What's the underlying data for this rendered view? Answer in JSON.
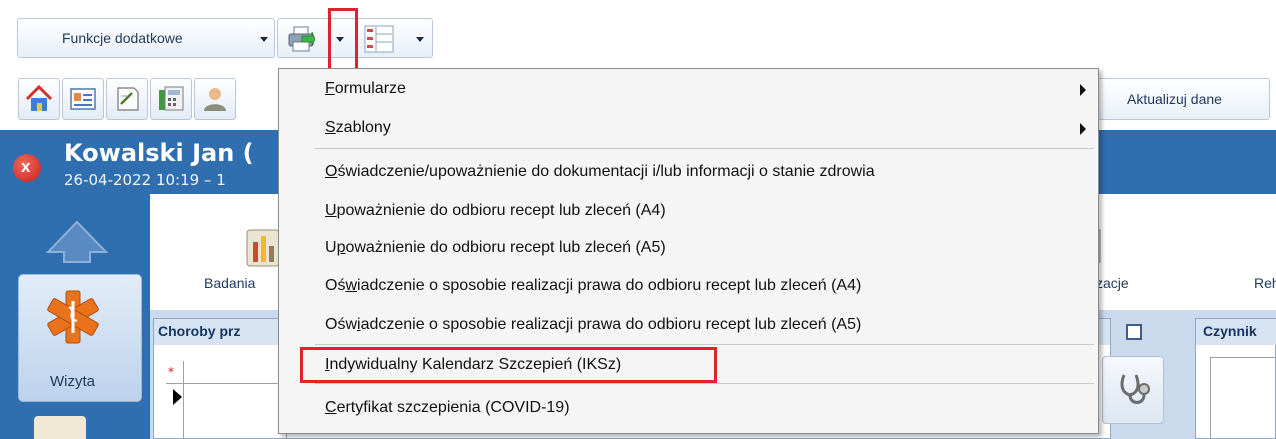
{
  "toolbar": {
    "funkcje_label": "Funkcje dodatkowe",
    "aktualizuj_label": "Aktualizuj dane",
    "icons": [
      "home-icon",
      "patient-card-icon",
      "notes-icon",
      "calculator-icon",
      "user-icon"
    ]
  },
  "patient": {
    "name": "Kowalski Jan (",
    "visit": "26-04-2022 10:19 – 1",
    "close_glyph": "x"
  },
  "nav": {
    "wizyta_label": "Wizyta"
  },
  "ribbon": {
    "badania_label": "Badania",
    "realizacje_label": "alizacje",
    "reh_label": "Reh"
  },
  "panels": {
    "choroby_title": "Choroby prz",
    "czynnik_title": "Czynnik",
    "grid_marker": "*"
  },
  "menu": {
    "items": [
      {
        "pre": "",
        "u": "F",
        "post": "ormularze",
        "submenu": true
      },
      {
        "pre": "",
        "u": "S",
        "post": "zablony",
        "submenu": true
      },
      {
        "pre": "",
        "u": "O",
        "post": "świadczenie/upoważnienie do dokumentacji i/lub informacji o stanie zdrowia",
        "submenu": false
      },
      {
        "pre": "",
        "u": "U",
        "post": "poważnienie do odbioru recept lub zleceń (A4)",
        "submenu": false
      },
      {
        "pre": "U",
        "u": "p",
        "post": "oważnienie do odbioru recept lub zleceń (A5)",
        "submenu": false
      },
      {
        "pre": "Oś",
        "u": "w",
        "post": "iadczenie o sposobie realizacji prawa do odbioru recept lub zleceń (A4)",
        "submenu": false
      },
      {
        "pre": "Ośw",
        "u": "i",
        "post": "adczenie o sposobie realizacji prawa do odbioru recept lub zleceń (A5)",
        "submenu": false
      },
      {
        "pre": "",
        "u": "I",
        "post": "ndywidualny Kalendarz Szczepień (IKSz)",
        "submenu": false
      },
      {
        "pre": "",
        "u": "C",
        "post": "ertyfikat szczepienia (COVID-19)",
        "submenu": false
      }
    ],
    "highlighted_item": "Indywidualny Kalendarz Szczepień (IKSz)",
    "highlight_color": "#e0212e"
  },
  "colors": {
    "header_blue": "#2f6eaf",
    "workspace_blue": "#cad9ec",
    "menu_bg": "#f5f5f5"
  }
}
